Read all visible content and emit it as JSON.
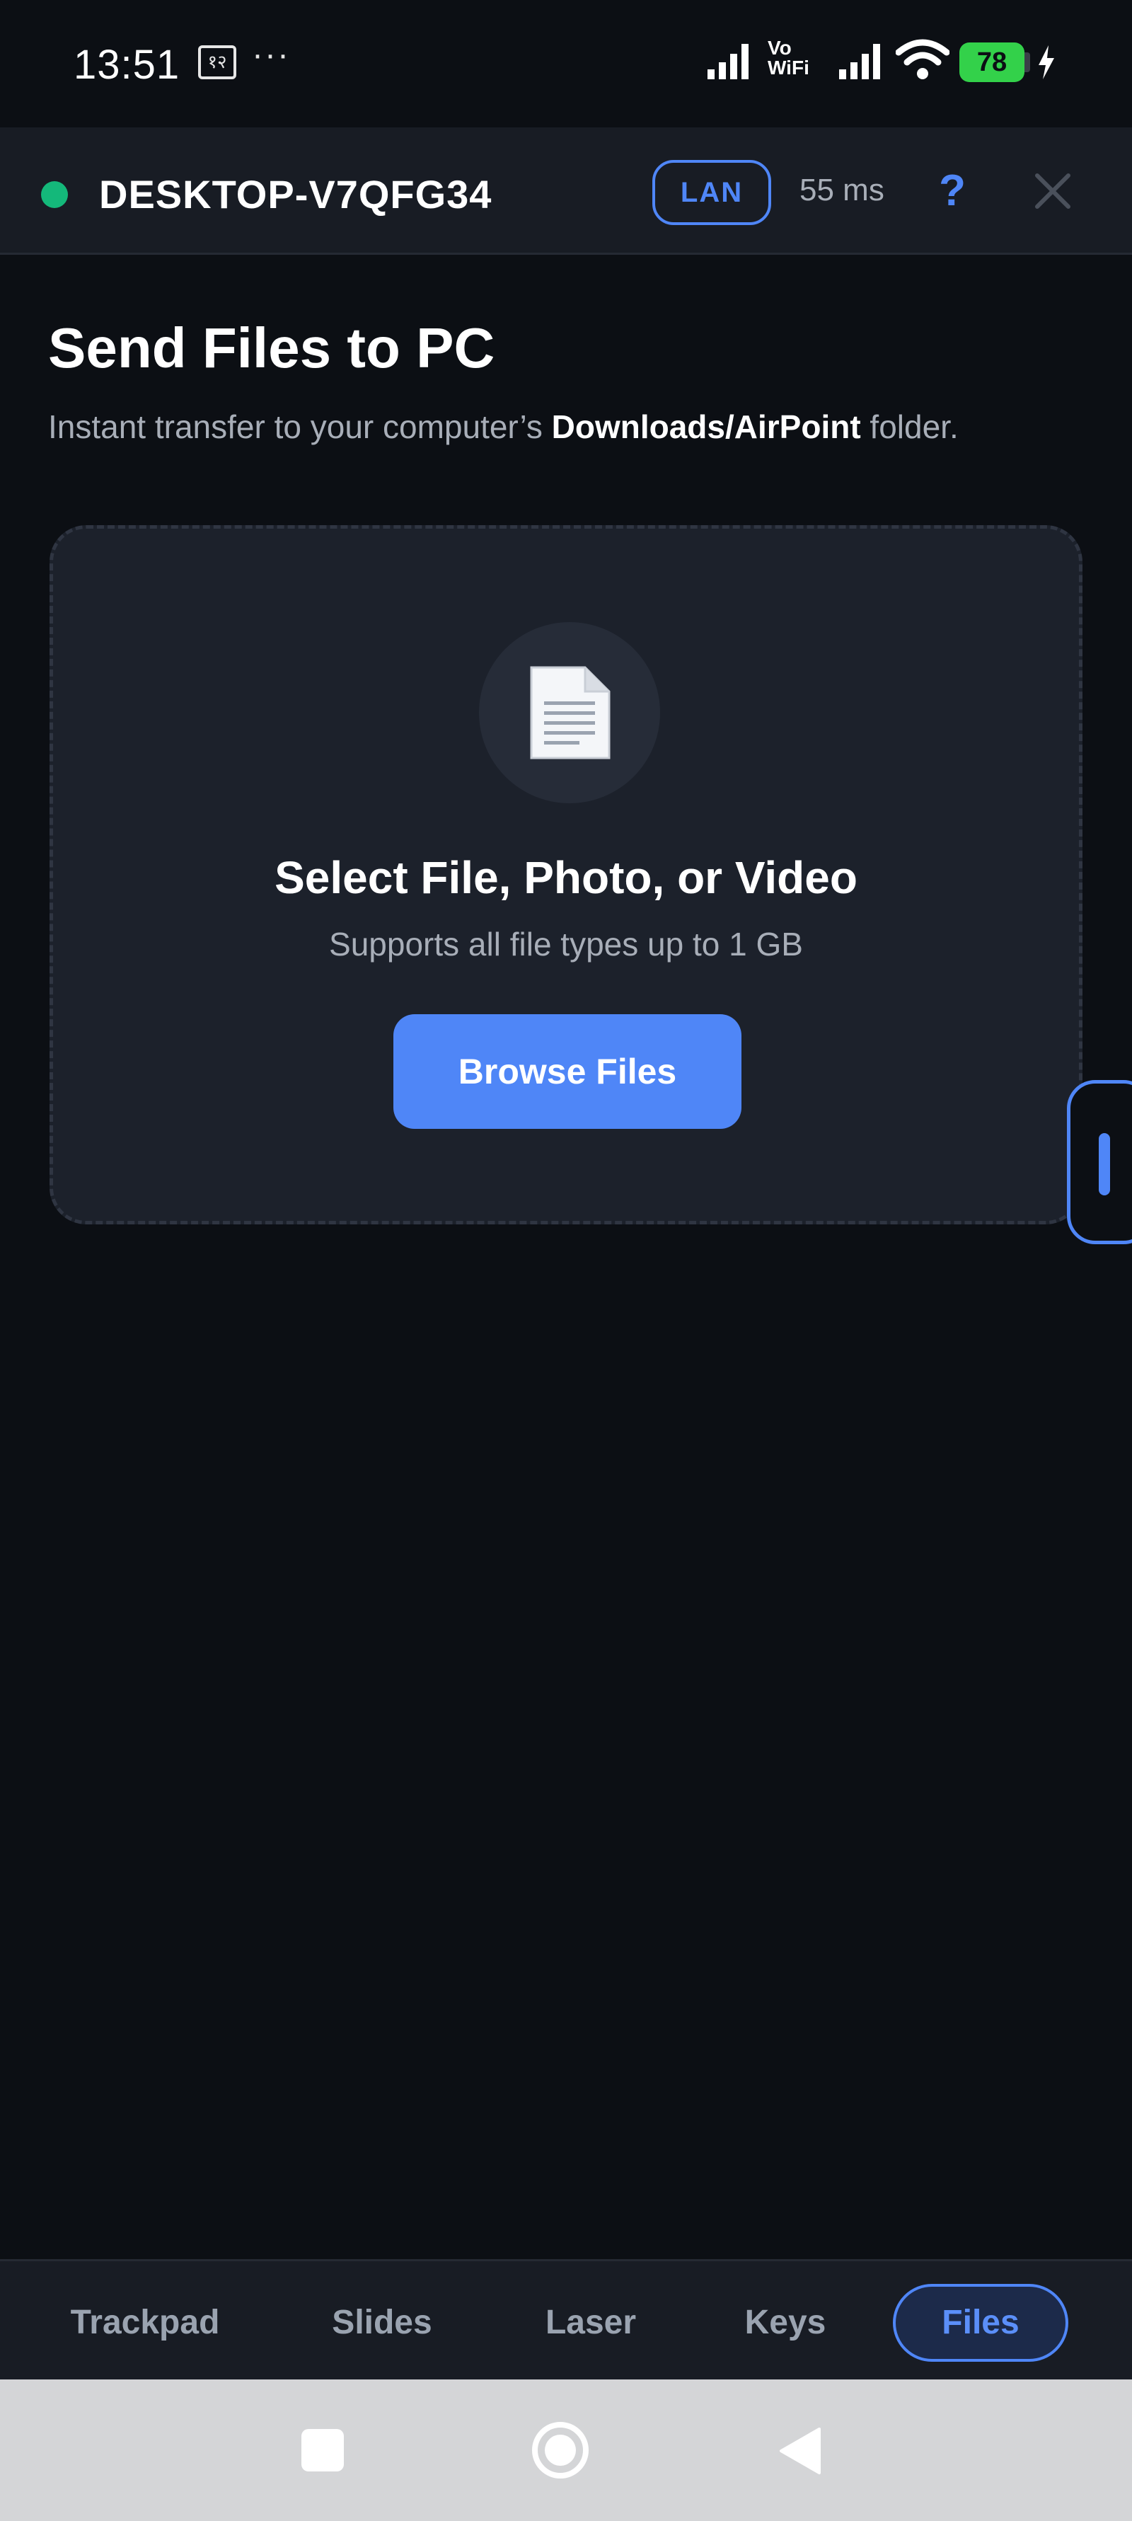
{
  "status_bar": {
    "time": "13:51",
    "notification_label": "१२",
    "more": "···",
    "vowifi": "Vo\nWiFi",
    "battery": "78"
  },
  "header": {
    "device_name": "DESKTOP-V7QFG34",
    "connection_type": "LAN",
    "latency": "55 ms",
    "help": "?",
    "status_color": "#14b87a",
    "accent_color": "#4f86f7"
  },
  "main": {
    "title": "Send Files to PC",
    "subtitle_prefix": "Instant transfer to your computer’s ",
    "subtitle_bold": "Downloads/AirPoint",
    "subtitle_suffix": " folder.",
    "drop_zone": {
      "icon": "file-icon",
      "title": "Select File, Photo, or Video",
      "subtitle": "Supports all file types up to 1 GB",
      "button_label": "Browse Files"
    }
  },
  "tabs": [
    {
      "label": "Trackpad",
      "active": false
    },
    {
      "label": "Slides",
      "active": false
    },
    {
      "label": "Laser",
      "active": false
    },
    {
      "label": "Keys",
      "active": false
    },
    {
      "label": "Files",
      "active": true
    }
  ],
  "system_nav": {
    "buttons": [
      "recents-icon",
      "home-icon",
      "back-icon"
    ]
  }
}
